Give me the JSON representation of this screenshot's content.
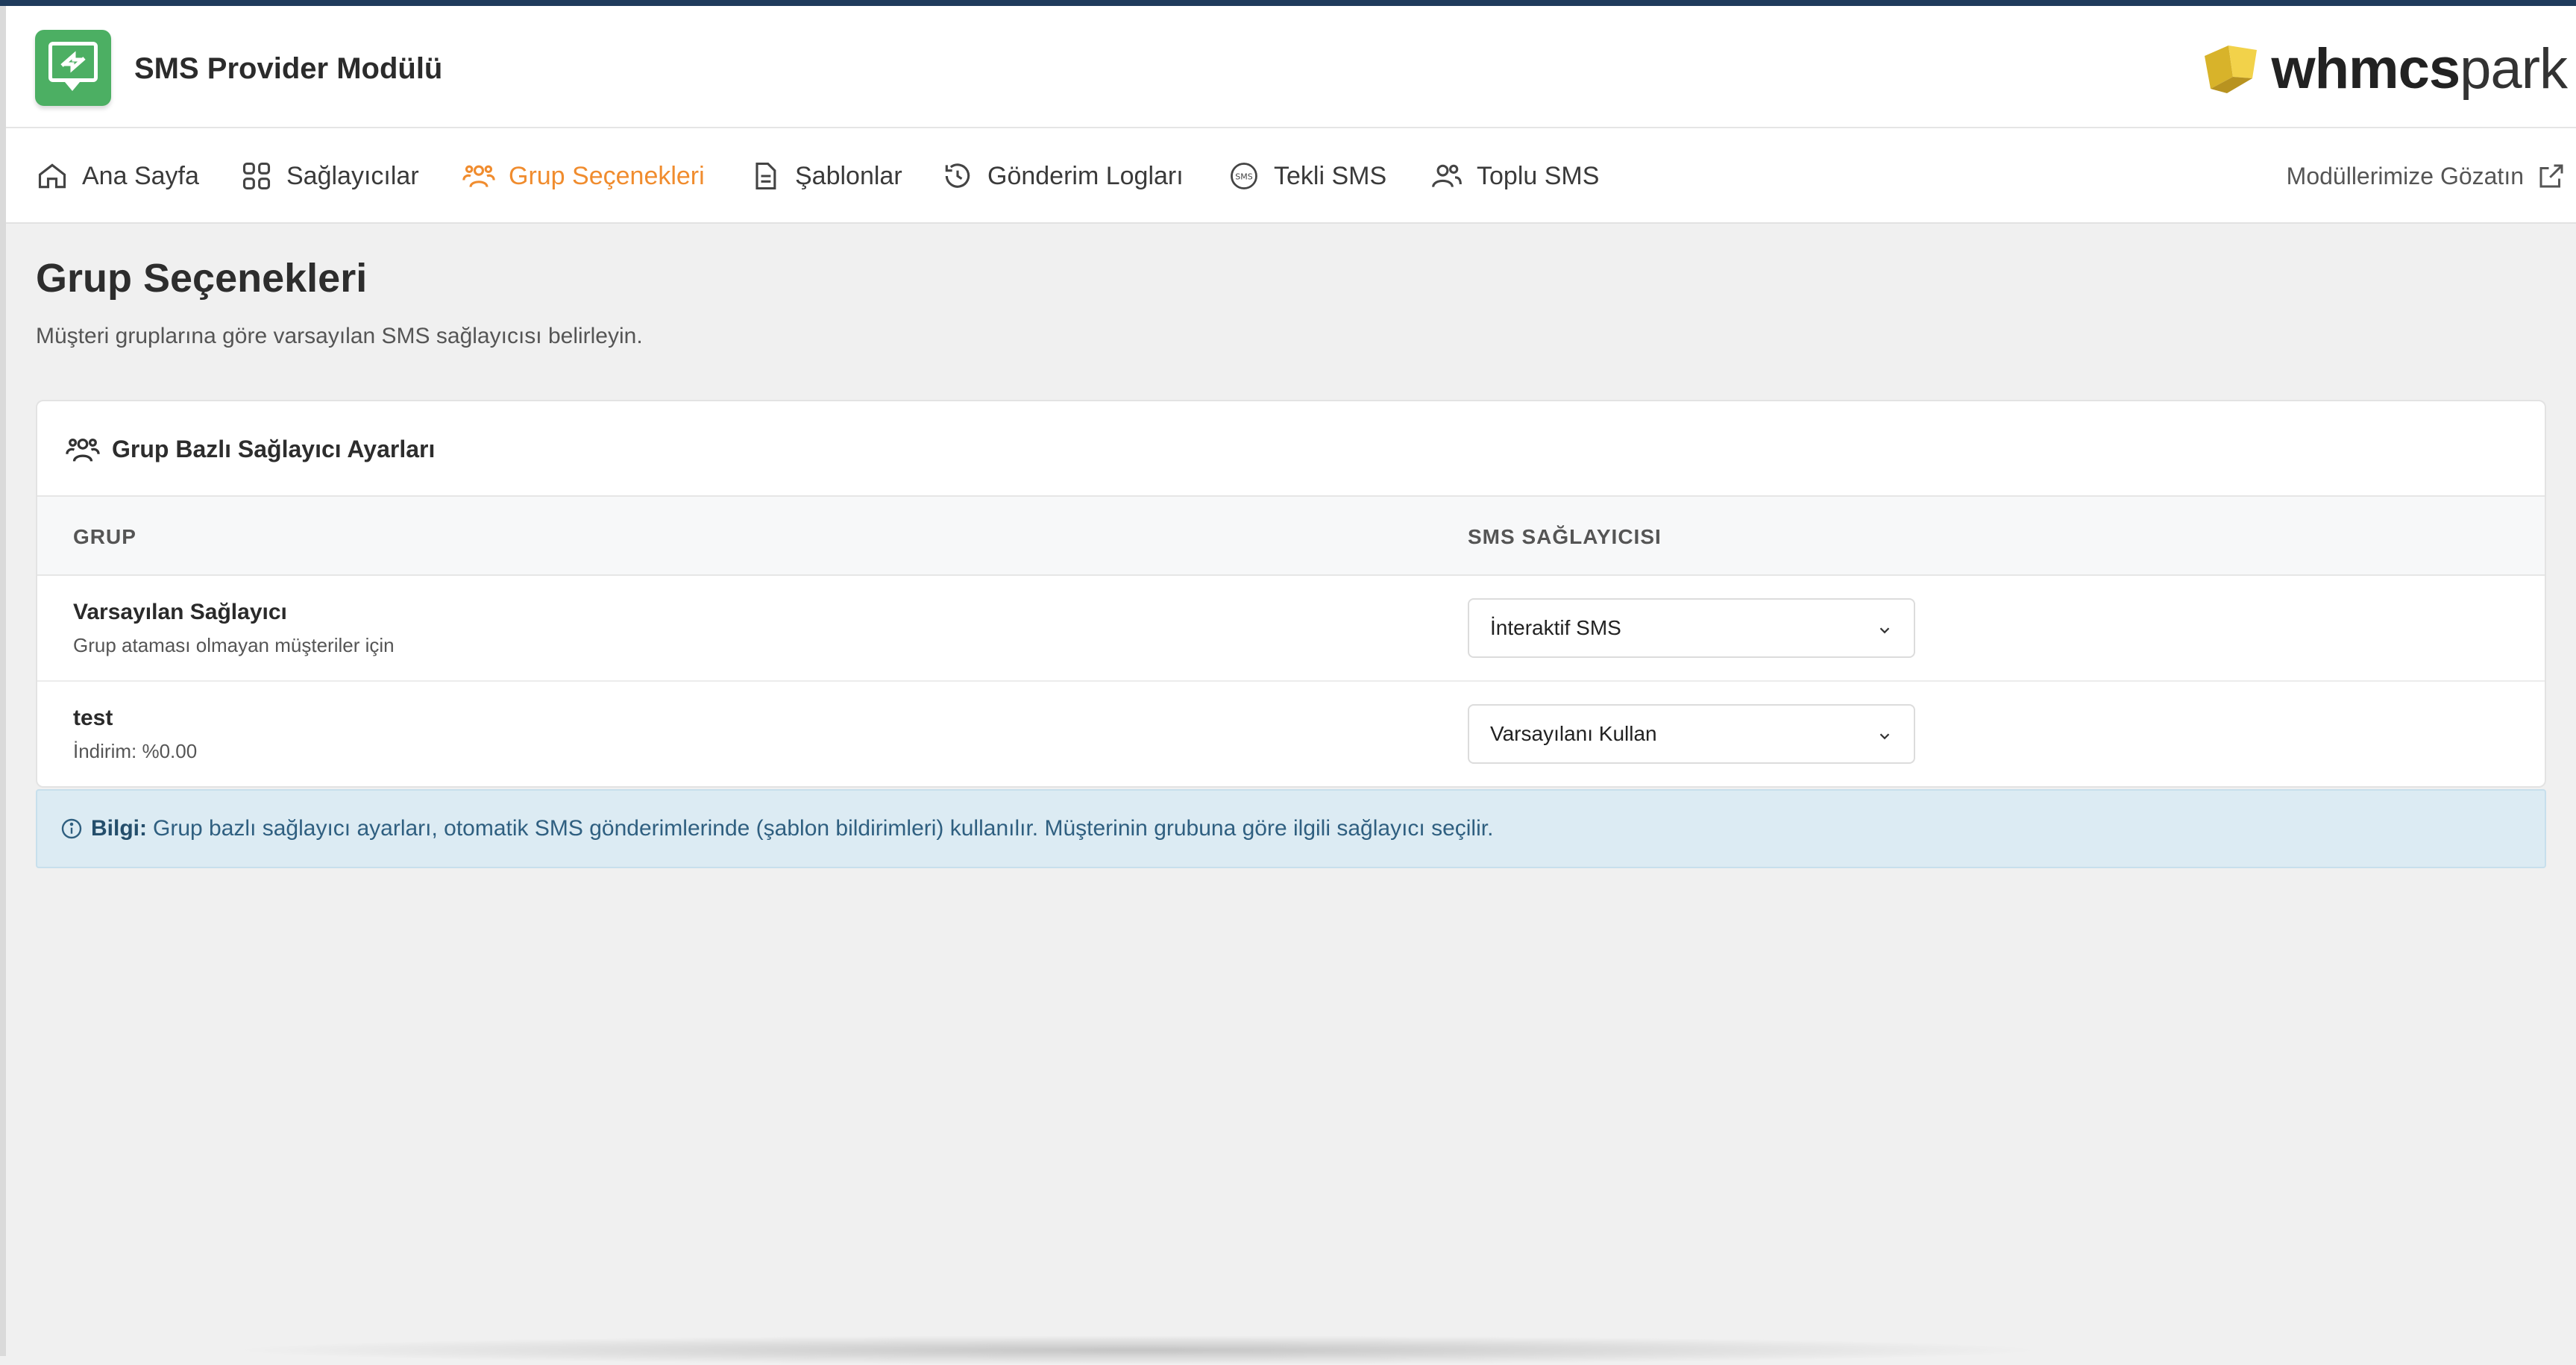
{
  "app": {
    "title": "SMS Provider Modülü",
    "icon": "sms-app-icon",
    "accent_color": "#4caf63"
  },
  "brand": {
    "text_bold": "whmcs",
    "text_light": "park",
    "mark_color": "#d8b32a"
  },
  "nav": {
    "active_color": "#f08c2e",
    "tabs": [
      {
        "label": "Ana Sayfa",
        "icon": "home-icon"
      },
      {
        "label": "Sağlayıcılar",
        "icon": "grid-icon"
      },
      {
        "label": "Grup Seçenekleri",
        "icon": "users-icon",
        "active": true
      },
      {
        "label": "Şablonlar",
        "icon": "document-icon"
      },
      {
        "label": "Gönderim Logları",
        "icon": "history-icon"
      },
      {
        "label": "Tekli SMS",
        "icon": "sms-icon"
      },
      {
        "label": "Toplu SMS",
        "icon": "user-group-icon"
      }
    ],
    "right_link": {
      "label": "Modüllerimize Gözatın",
      "icon": "external-link-icon"
    }
  },
  "page": {
    "title": "Grup Seçenekleri",
    "subtitle": "Müşteri gruplarına göre varsayılan SMS sağlayıcısı belirleyin."
  },
  "card": {
    "title": "Grup Bazlı Sağlayıcı Ayarları",
    "columns": [
      "GRUP",
      "SMS SAĞLAYICISI"
    ],
    "rows": [
      {
        "name": "Varsayılan Sağlayıcı",
        "desc": "Grup ataması olmayan müşteriler için",
        "provider": "İnteraktif SMS"
      },
      {
        "name": "test",
        "desc": "İndirim: %0.00",
        "provider": "Varsayılanı Kullan"
      }
    ]
  },
  "info": {
    "label": "Bilgi:",
    "text": "Grup bazlı sağlayıcı ayarları, otomatik SMS gönderimlerinde (şablon bildirimleri) kullanılır. Müşterinin grubuna göre ilgili sağlayıcı seçilir."
  }
}
